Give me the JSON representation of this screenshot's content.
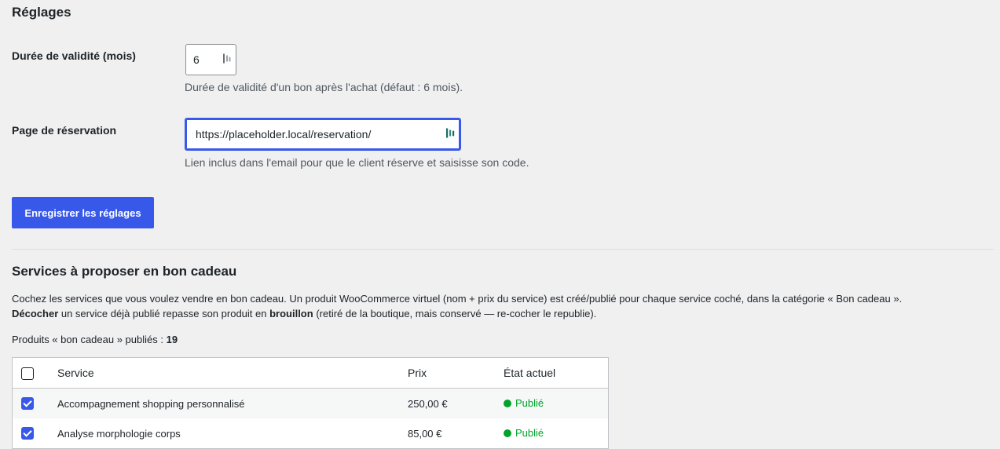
{
  "settings": {
    "title": "Réglages",
    "validity": {
      "label": "Durée de validité (mois)",
      "value": "6",
      "description": "Durée de validité d'un bon après l'achat (défaut : 6 mois)."
    },
    "reservation": {
      "label": "Page de réservation",
      "value": "https://placeholder.local/reservation/",
      "description": "Lien inclus dans l'email pour que le client réserve et saisisse son code."
    },
    "save_label": "Enregistrer les réglages"
  },
  "services": {
    "title": "Services à proposer en bon cadeau",
    "intro_line1": "Cochez les services que vous voulez vendre en bon cadeau. Un produit WooCommerce virtuel (nom + prix du service) est créé/publié pour chaque service coché, dans la catégorie « Bon cadeau ».",
    "intro_line2_bold": "Décocher",
    "intro_line2_a": " un service déjà publié repasse son produit en ",
    "intro_line2_bold2": "brouillon",
    "intro_line2_b": " (retiré de la boutique, mais conservé — re-cocher le republie).",
    "published_label": "Produits « bon cadeau » publiés : ",
    "published_count": "19",
    "columns": {
      "service": "Service",
      "price": "Prix",
      "status": "État actuel"
    },
    "rows": [
      {
        "name": "Accompagnement shopping personnalisé",
        "price": "250,00 €",
        "status": "Publié",
        "checked": true
      },
      {
        "name": "Analyse morphologie corps",
        "price": "85,00 €",
        "status": "Publié",
        "checked": true
      }
    ]
  },
  "colors": {
    "accent": "#3858e9",
    "published": "#00a32a",
    "background": "#f0f0f1"
  },
  "icons": {
    "password_manager": "password-manager-icon"
  }
}
